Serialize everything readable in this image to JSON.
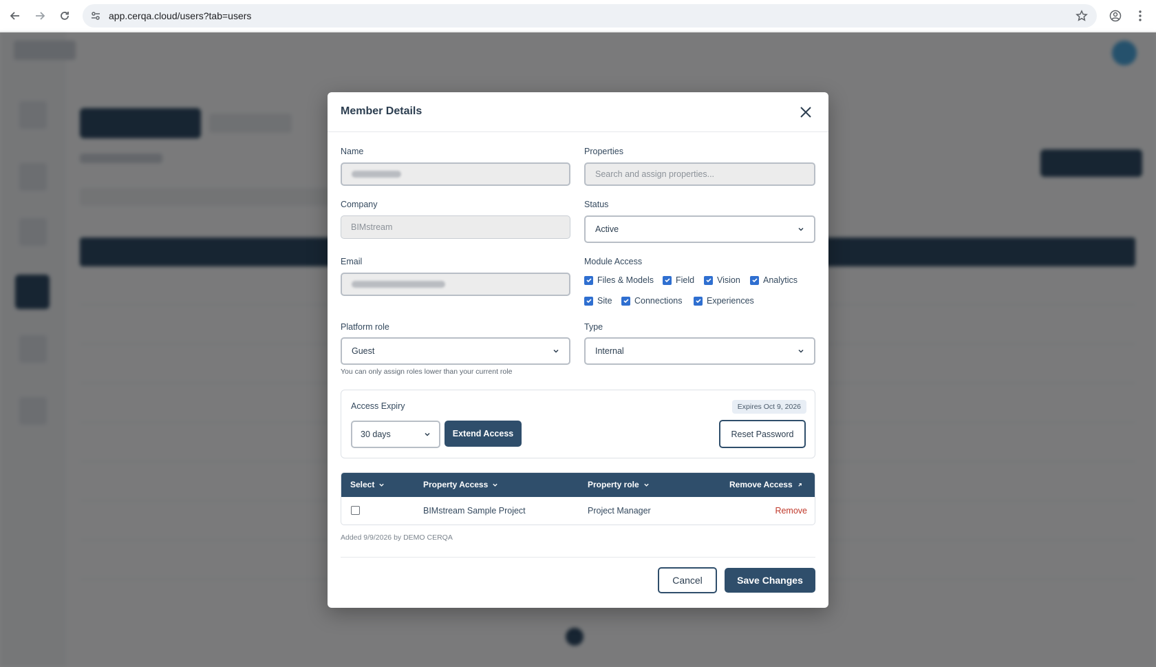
{
  "browser": {
    "url": "app.cerqa.cloud/users?tab=users",
    "back_icon": "arrow-left-icon",
    "forward_icon": "arrow-right-icon",
    "reload_icon": "reload-icon",
    "site_settings_icon": "tune-icon",
    "bookmark_icon": "star-icon",
    "profile_icon": "account-circle-icon",
    "menu_icon": "kebab-menu-icon"
  },
  "modal": {
    "title": "Member Details",
    "close_icon": "close-icon",
    "fields": {
      "name_label": "Name",
      "properties_label": "Properties",
      "properties_placeholder": "Search and assign properties...",
      "company_label": "Company",
      "company_value": "BIMstream",
      "status_label": "Status",
      "status_value": "Active",
      "email_label": "Email",
      "module_access_label": "Module Access",
      "platform_role_label": "Platform role",
      "platform_role_value": "Guest",
      "platform_role_hint": "You can only assign roles lower than your current role",
      "type_label": "Type",
      "type_value": "Internal"
    },
    "modules": [
      {
        "label": "Files & Models",
        "checked": true
      },
      {
        "label": "Field",
        "checked": true
      },
      {
        "label": "Vision",
        "checked": true
      },
      {
        "label": "Analytics",
        "checked": true
      },
      {
        "label": "Site",
        "checked": true
      },
      {
        "label": "Connections",
        "checked": true
      },
      {
        "label": "Experiences",
        "checked": true
      }
    ],
    "access_expiry": {
      "label": "Access Expiry",
      "badge": "Expires Oct 9, 2026",
      "duration_value": "30 days",
      "extend_button": "Extend Access",
      "reset_button": "Reset Password"
    },
    "table": {
      "headers": [
        "Select",
        "Property Access",
        "Property role",
        "Remove Access"
      ],
      "rows": [
        {
          "selected": false,
          "property": "BIMstream Sample Project",
          "role": "Project Manager",
          "action": "Remove"
        }
      ]
    },
    "added_note": "Added 9/9/2026 by DEMO CERQA",
    "cancel_button": "Cancel",
    "save_button": "Save Changes"
  },
  "colors": {
    "primary": "#2f4e6b",
    "checkbox": "#2f6fd0",
    "danger": "#c0392b",
    "overlay": "rgba(0,0,0,0.5)"
  }
}
